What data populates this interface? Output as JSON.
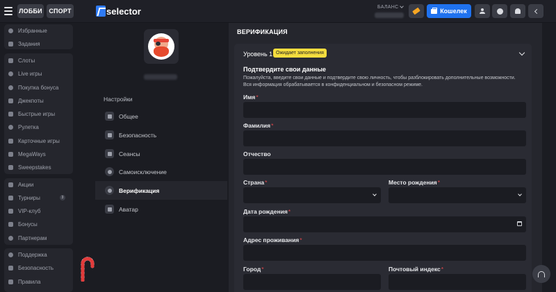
{
  "header": {
    "tabs": [
      {
        "label": "ЛОББИ"
      },
      {
        "label": "СПОРТ"
      }
    ],
    "logo_text": "selector",
    "balance_label": "БАЛАНС",
    "wallet_label": "Кошелек"
  },
  "sidebar": {
    "group1": [
      {
        "label": "Избранные",
        "icon": "heart-icon"
      },
      {
        "label": "Задания",
        "icon": "trophy-icon"
      }
    ],
    "group2": [
      {
        "label": "Слоты",
        "icon": "slots-icon"
      },
      {
        "label": "Live игры",
        "icon": "live-icon"
      },
      {
        "label": "Покупка бонуса",
        "icon": "bonus-buy-icon"
      },
      {
        "label": "Джекпоты",
        "icon": "jackpot-icon"
      },
      {
        "label": "Быстрые игры",
        "icon": "fast-games-icon"
      },
      {
        "label": "Рулетка",
        "icon": "roulette-icon"
      },
      {
        "label": "Карточные игры",
        "icon": "cards-icon"
      },
      {
        "label": "MegaWays",
        "icon": "megaways-icon"
      },
      {
        "label": "Sweepstakes",
        "icon": "sweepstakes-icon"
      }
    ],
    "group3": [
      {
        "label": "Акции",
        "icon": "gift-icon"
      },
      {
        "label": "Турниры",
        "icon": "tournament-icon",
        "badge": "3"
      },
      {
        "label": "VIP-клуб",
        "icon": "star-icon"
      },
      {
        "label": "Бонусы",
        "icon": "bonus-icon"
      },
      {
        "label": "Партнерам",
        "icon": "partners-icon"
      }
    ],
    "group4": [
      {
        "label": "Поддержка",
        "icon": "support-icon"
      },
      {
        "label": "Безопасность",
        "icon": "security-icon"
      },
      {
        "label": "Правила",
        "icon": "rules-icon"
      }
    ]
  },
  "profile": {
    "settings_title": "Настройки",
    "menu": [
      {
        "label": "Общее",
        "icon": "gear-icon"
      },
      {
        "label": "Безопасность",
        "icon": "scales-icon"
      },
      {
        "label": "Сеансы",
        "icon": "sessions-icon"
      },
      {
        "label": "Самоисключение",
        "icon": "self-exclusion-icon"
      },
      {
        "label": "Верификация",
        "icon": "shield-icon",
        "active": true
      },
      {
        "label": "Аватар",
        "icon": "avatar-icon"
      }
    ]
  },
  "verification": {
    "title": "ВЕРИФИКАЦИЯ",
    "level_title": "Уровень 1",
    "level_badge": "Ожидает заполнения",
    "section_title": "Подтвердите свои данные",
    "section_desc": "Пожалуйста, введите свои данные и подтвердите свою личность, чтобы разблокировать дополнительные возможности. Вся информация обрабатывается в конфиденциальном и безопасном режиме.",
    "fields": {
      "first_name": {
        "label": "Имя",
        "required": "*",
        "value": ""
      },
      "last_name": {
        "label": "Фамилия",
        "required": "*",
        "value": ""
      },
      "middle_name": {
        "label": "Отчество",
        "required": "",
        "value": ""
      },
      "country": {
        "label": "Страна",
        "required": "*",
        "value": ""
      },
      "birth_place": {
        "label": "Место рождения",
        "required": "*",
        "value": ""
      },
      "birth_date": {
        "label": "Дата рождения",
        "required": "*",
        "value": ""
      },
      "address": {
        "label": "Адрес проживания",
        "required": "*",
        "value": ""
      },
      "city": {
        "label": "Город",
        "required": "*",
        "value": ""
      },
      "postal_code": {
        "label": "Почтовый индекс",
        "required": "*",
        "value": ""
      }
    }
  }
}
